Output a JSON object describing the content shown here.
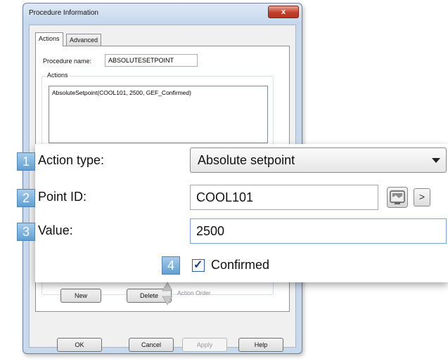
{
  "dialog": {
    "title": "Procedure Information",
    "close_label": "x",
    "tabs": [
      {
        "label": "Actions",
        "active": true
      },
      {
        "label": "Advanced",
        "active": false
      }
    ],
    "procedure_name_label": "Procedure name:",
    "procedure_name_value": "ABSOLUTESETPOINT",
    "actions_group_label": "Actions",
    "actions_list": [
      "AbsoluteSetpoint(COOL101, 2500, GEF_Confirmed)"
    ],
    "action_buttons": {
      "new": "New",
      "delete": "Delete",
      "action_order": "Action Order"
    },
    "footer_buttons": {
      "ok": "OK",
      "cancel": "Cancel",
      "apply": "Apply",
      "help": "Help"
    }
  },
  "overlay": {
    "action_type": {
      "number": "1",
      "label": "Action type:",
      "value": "Absolute setpoint"
    },
    "point_id": {
      "number": "2",
      "label": "Point ID:",
      "value": "COOL101",
      "next_label": ">"
    },
    "value_field": {
      "number": "3",
      "label": "Value:",
      "value": "2500"
    },
    "confirmed": {
      "number": "4",
      "label": "Confirmed",
      "checked": true,
      "check_glyph": "✓"
    }
  },
  "colors": {
    "badge": "#5f9fd3",
    "dialog_frame": "#c9d9ec",
    "close_button": "#c3402a"
  },
  "icons": {
    "point_picker": "point-browser-icon",
    "dropdown": "chevron-down-icon"
  }
}
